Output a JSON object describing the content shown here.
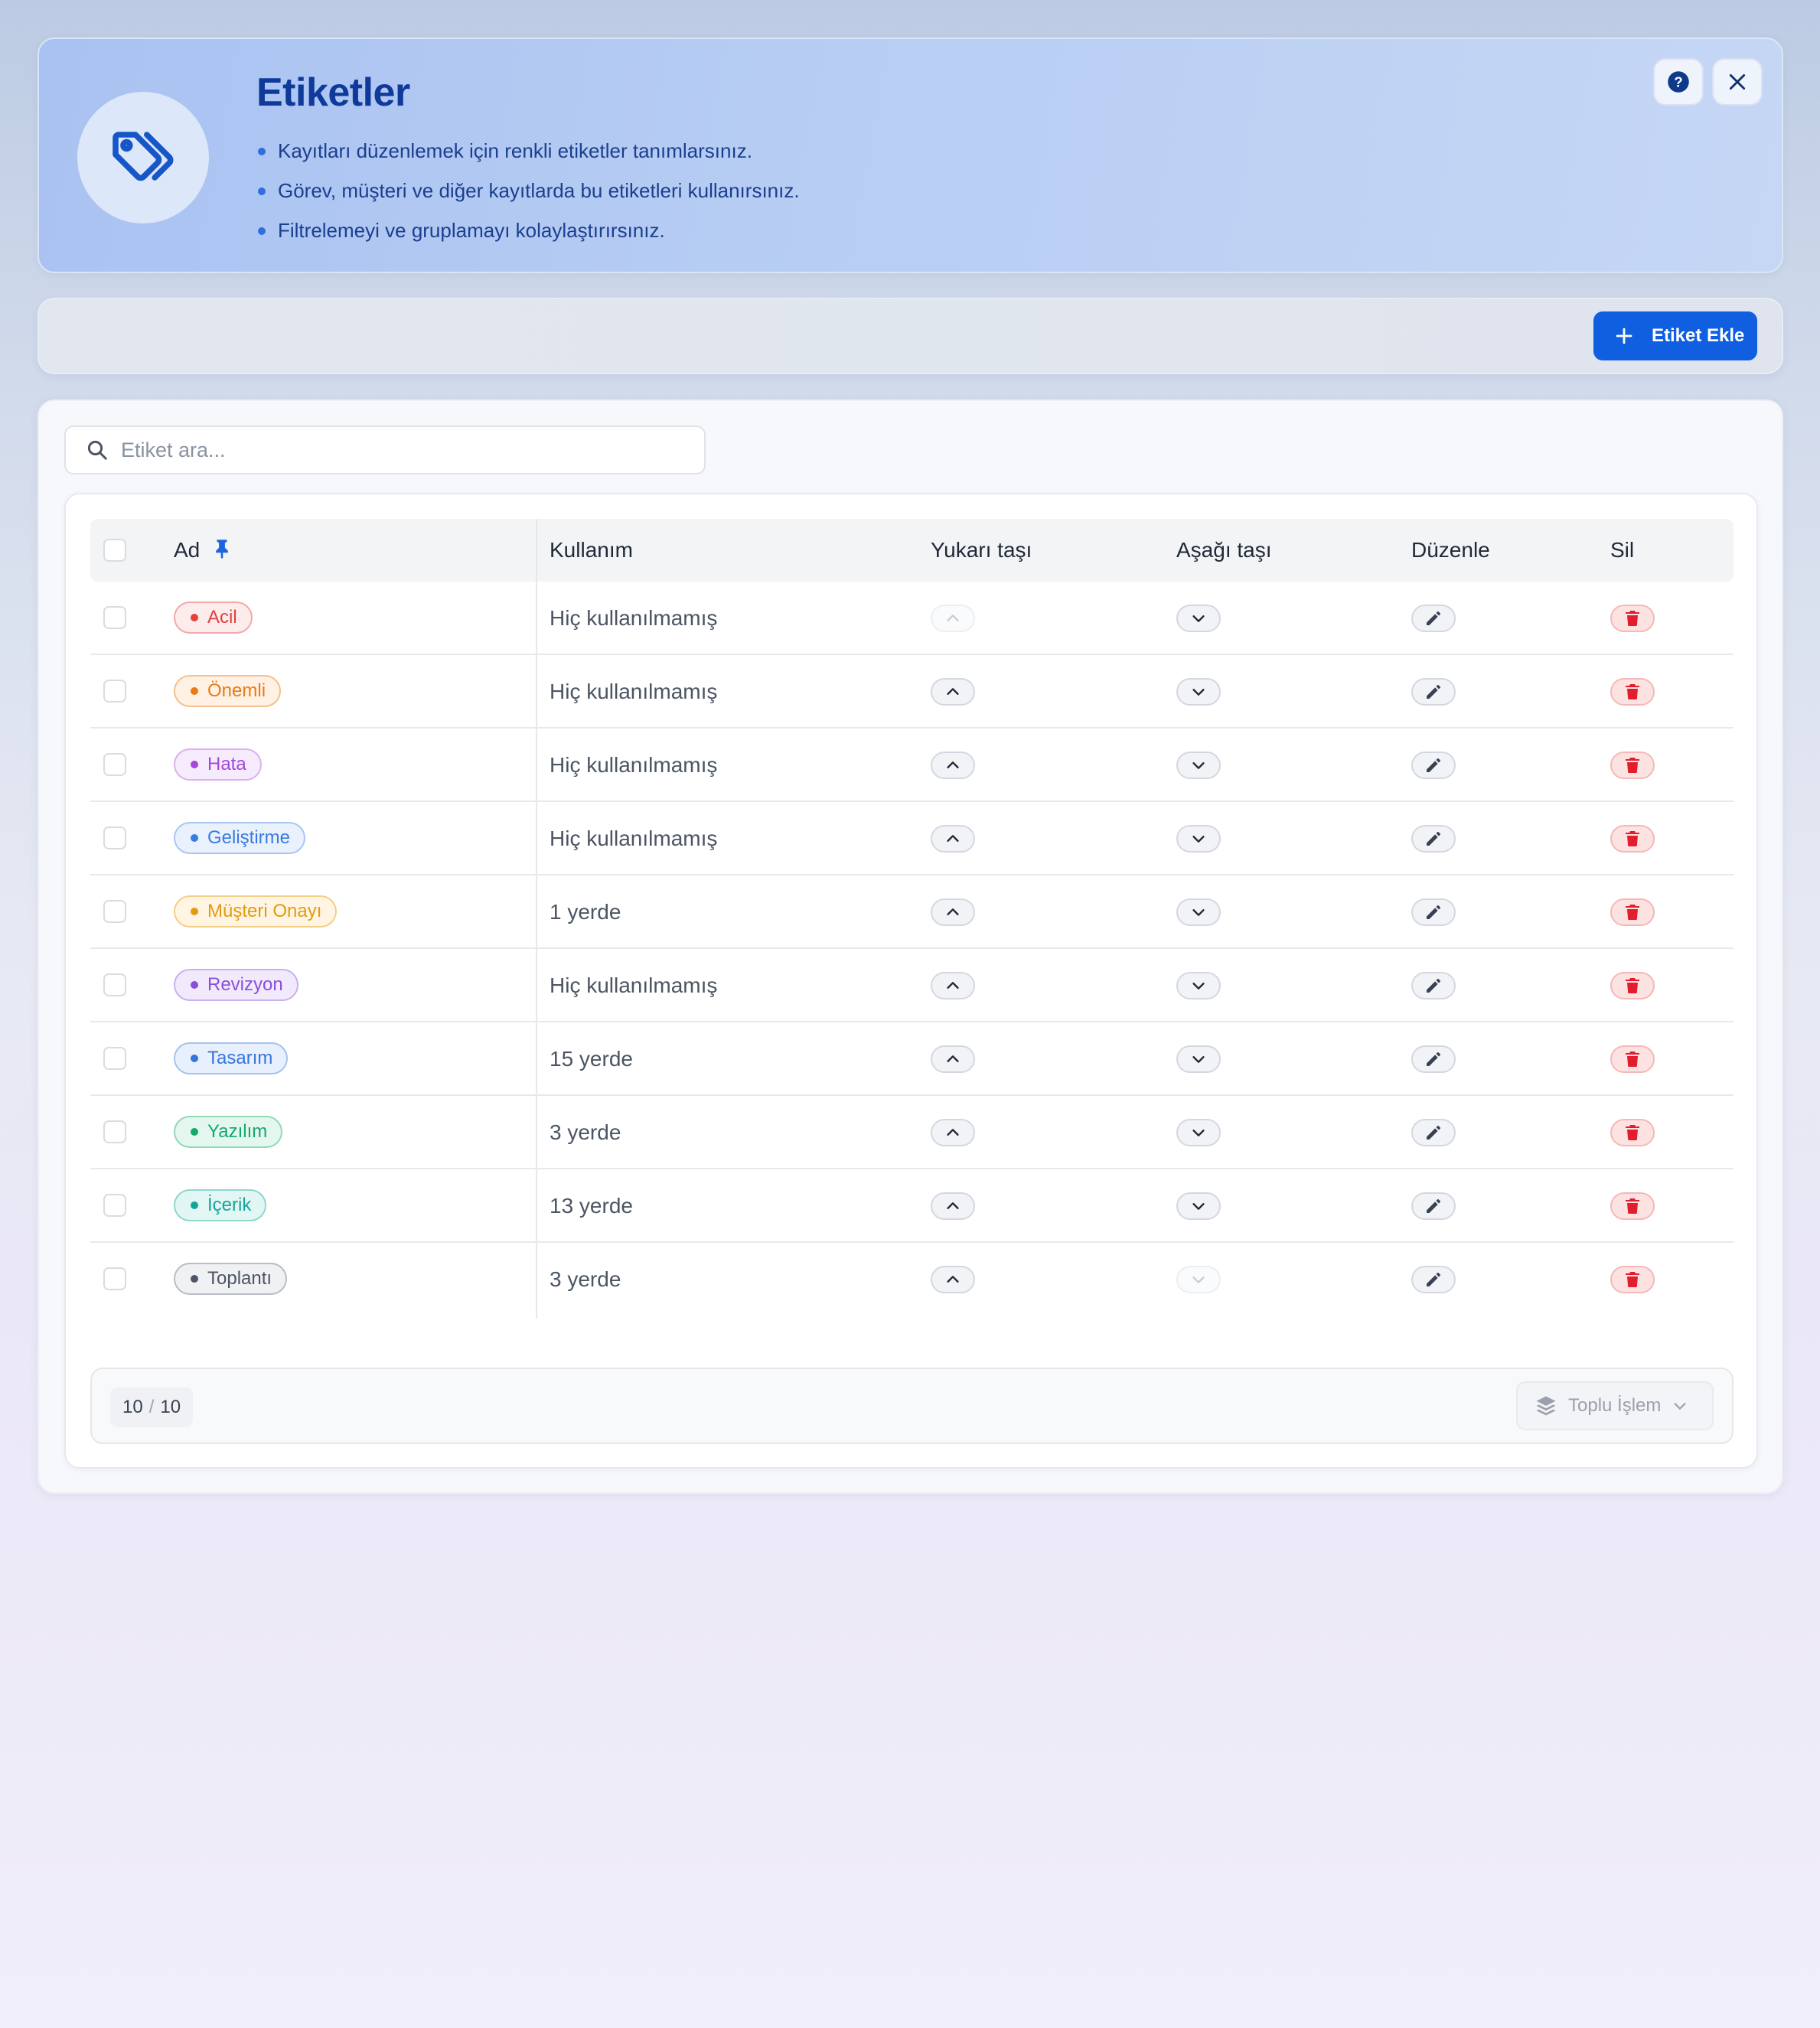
{
  "header": {
    "title": "Etiketler",
    "bullets": [
      "Kayıtları düzenlemek için renkli etiketler tanımlarsınız.",
      "Görev, müşteri ve diğer kayıtlarda bu etiketleri kullanırsınız.",
      "Filtrelemeyi ve gruplamayı kolaylaştırırsınız."
    ],
    "icon": "tags-icon",
    "help_icon": "question-circle-icon",
    "close_icon": "close-icon"
  },
  "toolbar": {
    "add_label": "Etiket Ekle",
    "add_icon": "plus-icon"
  },
  "search": {
    "placeholder": "Etiket ara...",
    "value": "",
    "icon": "search-icon"
  },
  "table": {
    "columns": {
      "name": "Ad",
      "usage": "Kullanım",
      "up": "Yukarı taşı",
      "down": "Aşağı taşı",
      "edit": "Düzenle",
      "delete": "Sil"
    },
    "rows": [
      {
        "name": "Acil",
        "usage": "Hiç kullanılmamış",
        "color": "#e53e3e",
        "bg": "#fdecec",
        "border": "#f2a9a9",
        "up_disabled": true,
        "down_disabled": false
      },
      {
        "name": "Önemli",
        "usage": "Hiç kullanılmamış",
        "color": "#ea7a12",
        "bg": "#fff1e4",
        "border": "#f5bf8b",
        "up_disabled": false,
        "down_disabled": false
      },
      {
        "name": "Hata",
        "usage": "Hiç kullanılmamış",
        "color": "#a348d8",
        "bg": "#f6ebfc",
        "border": "#d9b2ef",
        "up_disabled": false,
        "down_disabled": false
      },
      {
        "name": "Geliştirme",
        "usage": "Hiç kullanılmamış",
        "color": "#3b7ae0",
        "bg": "#e9f1fd",
        "border": "#a9c6f1",
        "up_disabled": false,
        "down_disabled": false
      },
      {
        "name": "Müşteri Onayı",
        "usage": "1 yerde",
        "color": "#e39a12",
        "bg": "#fff5e2",
        "border": "#f3cf86",
        "up_disabled": false,
        "down_disabled": false
      },
      {
        "name": "Revizyon",
        "usage": "Hiç kullanılmamış",
        "color": "#8a4fd9",
        "bg": "#f1eafd",
        "border": "#c9b0ef",
        "up_disabled": false,
        "down_disabled": false
      },
      {
        "name": "Tasarım",
        "usage": "15 yerde",
        "color": "#3676db",
        "bg": "#e8f0fd",
        "border": "#a7c2ef",
        "up_disabled": false,
        "down_disabled": false
      },
      {
        "name": "Yazılım",
        "usage": "3 yerde",
        "color": "#12a96b",
        "bg": "#e4f7ee",
        "border": "#93d9b7",
        "up_disabled": false,
        "down_disabled": false
      },
      {
        "name": "İçerik",
        "usage": "13 yerde",
        "color": "#12a69a",
        "bg": "#e2f6f4",
        "border": "#8fd7cf",
        "up_disabled": false,
        "down_disabled": false
      },
      {
        "name": "Toplantı",
        "usage": "3 yerde",
        "color": "#4b5563",
        "bg": "#f0f1f3",
        "border": "#b8bdc6",
        "up_disabled": false,
        "down_disabled": true
      }
    ]
  },
  "footer": {
    "shown": "10",
    "separator": "/",
    "total": "10",
    "bulk_label": "Toplu İşlem",
    "bulk_icon": "layers-icon"
  }
}
